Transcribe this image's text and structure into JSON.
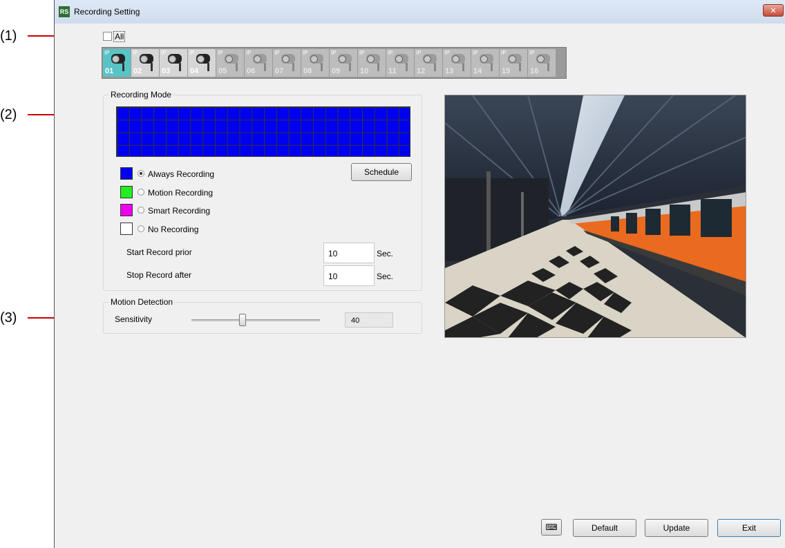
{
  "callouts": [
    "(1)",
    "(2)",
    "(3)"
  ],
  "window": {
    "title": "Recording Setting",
    "close_glyph": "✕"
  },
  "channels": {
    "all_label": "All",
    "cameras": [
      {
        "ip": "IP",
        "num": "01",
        "state": "selected"
      },
      {
        "ip": "IP",
        "num": "02",
        "state": "active"
      },
      {
        "ip": "IP",
        "num": "03",
        "state": "active"
      },
      {
        "ip": "IP",
        "num": "04",
        "state": "active"
      },
      {
        "ip": "IP",
        "num": "05",
        "state": "inactive"
      },
      {
        "ip": "IP",
        "num": "06",
        "state": "inactive"
      },
      {
        "ip": "IP",
        "num": "07",
        "state": "inactive"
      },
      {
        "ip": "IP",
        "num": "08",
        "state": "inactive"
      },
      {
        "ip": "IP",
        "num": "09",
        "state": "inactive"
      },
      {
        "ip": "IP",
        "num": "10",
        "state": "inactive"
      },
      {
        "ip": "IP",
        "num": "11",
        "state": "inactive"
      },
      {
        "ip": "IP",
        "num": "12",
        "state": "inactive"
      },
      {
        "ip": "IP",
        "num": "13",
        "state": "inactive"
      },
      {
        "ip": "IP",
        "num": "14",
        "state": "inactive"
      },
      {
        "ip": "IP",
        "num": "15",
        "state": "inactive"
      },
      {
        "ip": "IP",
        "num": "16",
        "state": "inactive"
      }
    ]
  },
  "recording_mode": {
    "legend": "Recording Mode",
    "schedule_color": "#0000ee",
    "modes": [
      {
        "label": "Always Recording",
        "color": "#0000ee",
        "selected": true
      },
      {
        "label": "Motion Recording",
        "color": "#22ee22",
        "selected": false
      },
      {
        "label": "Smart Recording",
        "color": "#ee00ee",
        "selected": false
      },
      {
        "label": "No Recording",
        "color": "#ffffff",
        "selected": false
      }
    ],
    "schedule_button": "Schedule",
    "start_prior": {
      "label": "Start Record prior",
      "value": "10",
      "unit": "Sec."
    },
    "stop_after": {
      "label": "Stop Record after",
      "value": "10",
      "unit": "Sec."
    }
  },
  "motion_detection": {
    "legend": "Motion Detection",
    "sensitivity_label": "Sensitivity",
    "sensitivity_value": "40",
    "sensitivity_fraction": 0.4
  },
  "preview": {
    "icon": "camera-preview-image"
  },
  "buttons": {
    "keyboard_icon": "keyboard-icon",
    "default": "Default",
    "update": "Update",
    "exit": "Exit"
  }
}
